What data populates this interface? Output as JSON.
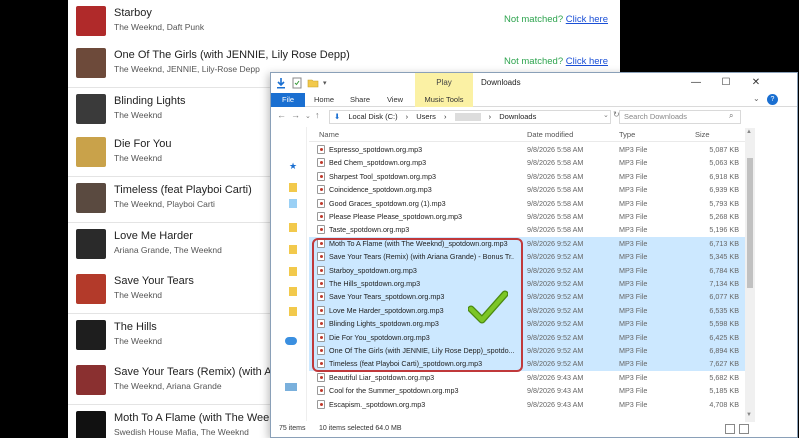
{
  "songs": [
    {
      "title": "Starboy",
      "artist": "The Weeknd, Daft Punk",
      "status": "Not matched?",
      "link": "Click here",
      "thumb_color": "#b02a2a"
    },
    {
      "title": "One Of The Girls (with JENNIE, Lily Rose Depp)",
      "artist": "The Weeknd, JENNIE, Lily-Rose Depp",
      "status": "Not matched?",
      "link": "Click here",
      "thumb_color": "#6d4a3a"
    },
    {
      "title": "Blinding Lights",
      "artist": "The Weeknd",
      "thumb_color": "#3a3a3a"
    },
    {
      "title": "Die For You",
      "artist": "The Weeknd",
      "thumb_color": "#c9a24a"
    },
    {
      "title": "Timeless (feat Playboi Carti)",
      "artist": "The Weeknd, Playboi Carti",
      "thumb_color": "#5a4a40"
    },
    {
      "title": "Love Me Harder",
      "artist": "Ariana Grande, The Weeknd",
      "thumb_color": "#2a2a2a"
    },
    {
      "title": "Save Your Tears",
      "artist": "The Weeknd",
      "thumb_color": "#b33a2a"
    },
    {
      "title": "The Hills",
      "artist": "The Weeknd",
      "thumb_color": "#1e1e1e"
    },
    {
      "title": "Save Your Tears (Remix) (with Ariana",
      "artist": "The Weeknd, Ariana Grande",
      "thumb_color": "#8a3030"
    },
    {
      "title": "Moth To A Flame (with The Weeknd)",
      "artist": "Swedish House Mafia, The Weeknd",
      "thumb_color": "#111111"
    }
  ],
  "explorer": {
    "play_tab": "Play",
    "title": "Downloads",
    "ribbon_tabs": [
      "File",
      "Home",
      "Share",
      "View",
      "Music Tools"
    ],
    "address": [
      "Local Disk (C:)",
      "›",
      "Users",
      "›",
      "›",
      "Downloads"
    ],
    "search_placeholder": "Search Downloads",
    "columns": [
      "Name",
      "Date modified",
      "Type",
      "Size"
    ],
    "files": [
      {
        "name": "Espresso_spotdown.org.mp3",
        "date": "9/8/2026 5:58 AM",
        "type": "MP3 File",
        "size": "5,087 KB",
        "selected": false
      },
      {
        "name": "Bed Chem_spotdown.org.mp3",
        "date": "9/8/2026 5:58 AM",
        "type": "MP3 File",
        "size": "5,063 KB",
        "selected": false
      },
      {
        "name": "Sharpest Tool_spotdown.org.mp3",
        "date": "9/8/2026 5:58 AM",
        "type": "MP3 File",
        "size": "6,918 KB",
        "selected": false
      },
      {
        "name": "Coincidence_spotdown.org.mp3",
        "date": "9/8/2026 5:58 AM",
        "type": "MP3 File",
        "size": "6,939 KB",
        "selected": false
      },
      {
        "name": "Good Graces_spotdown.org (1).mp3",
        "date": "9/8/2026 5:58 AM",
        "type": "MP3 File",
        "size": "5,793 KB",
        "selected": false
      },
      {
        "name": "Please Please Please_spotdown.org.mp3",
        "date": "9/8/2026 5:58 AM",
        "type": "MP3 File",
        "size": "5,268 KB",
        "selected": false
      },
      {
        "name": "Taste_spotdown.org.mp3",
        "date": "9/8/2026 5:58 AM",
        "type": "MP3 File",
        "size": "5,196 KB",
        "selected": false
      },
      {
        "name": "Moth To A Flame (with The Weeknd)_spotdown.org.mp3",
        "date": "9/8/2026 9:52 AM",
        "type": "MP3 File",
        "size": "6,713 KB",
        "selected": true
      },
      {
        "name": "Save Your Tears (Remix) (with Ariana Grande) - Bonus Tr...",
        "date": "9/8/2026 9:52 AM",
        "type": "MP3 File",
        "size": "5,345 KB",
        "selected": true
      },
      {
        "name": "Starboy_spotdown.org.mp3",
        "date": "9/8/2026 9:52 AM",
        "type": "MP3 File",
        "size": "6,784 KB",
        "selected": true
      },
      {
        "name": "The Hills_spotdown.org.mp3",
        "date": "9/8/2026 9:52 AM",
        "type": "MP3 File",
        "size": "7,134 KB",
        "selected": true
      },
      {
        "name": "Save Your Tears_spotdown.org.mp3",
        "date": "9/8/2026 9:52 AM",
        "type": "MP3 File",
        "size": "6,077 KB",
        "selected": true
      },
      {
        "name": "Love Me Harder_spotdown.org.mp3",
        "date": "9/8/2026 9:52 AM",
        "type": "MP3 File",
        "size": "6,535 KB",
        "selected": true
      },
      {
        "name": "Blinding Lights_spotdown.org.mp3",
        "date": "9/8/2026 9:52 AM",
        "type": "MP3 File",
        "size": "5,598 KB",
        "selected": true
      },
      {
        "name": "Die For You_spotdown.org.mp3",
        "date": "9/8/2026 9:52 AM",
        "type": "MP3 File",
        "size": "6,425 KB",
        "selected": true
      },
      {
        "name": "One Of The Girls (with JENNIE, Lily Rose Depp)_spotdo...",
        "date": "9/8/2026 9:52 AM",
        "type": "MP3 File",
        "size": "6,894 KB",
        "selected": true
      },
      {
        "name": "Timeless (feat Playboi Carti)_spotdown.org.mp3",
        "date": "9/8/2026 9:52 AM",
        "type": "MP3 File",
        "size": "7,627 KB",
        "selected": true
      },
      {
        "name": "Beautiful Liar_spotdown.org.mp3",
        "date": "9/8/2026 9:43 AM",
        "type": "MP3 File",
        "size": "5,682 KB",
        "selected": false
      },
      {
        "name": "Cool for the Summer_spotdown.org.mp3",
        "date": "9/8/2026 9:43 AM",
        "type": "MP3 File",
        "size": "5,185 KB",
        "selected": false
      },
      {
        "name": "Escapism._spotdown.org.mp3",
        "date": "9/8/2026 9:43 AM",
        "type": "MP3 File",
        "size": "4,708 KB",
        "selected": false
      }
    ],
    "status_items": "75 items",
    "status_selected": "10 items selected  64.0 MB"
  },
  "colors": {
    "matched_green": "#2ea44f",
    "link_blue": "#1a4fd6",
    "selection": "#cce8ff",
    "highlight_red": "#c0393b",
    "check_green": "#7cc627"
  }
}
